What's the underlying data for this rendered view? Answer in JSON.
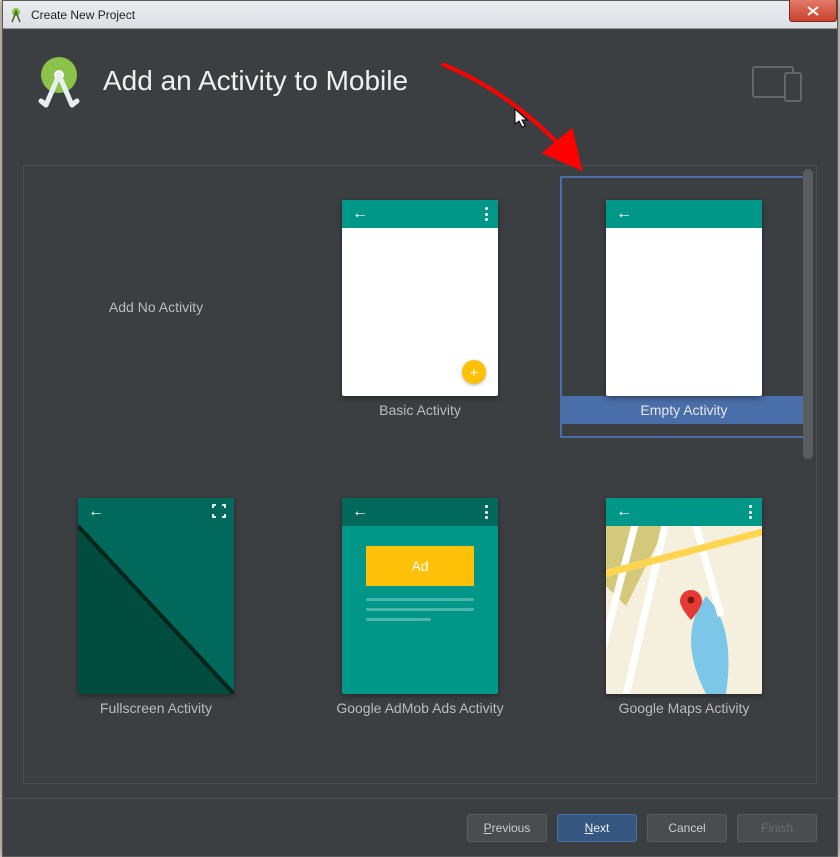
{
  "window": {
    "title": "Create New Project",
    "close_label": "X"
  },
  "header": {
    "title": "Add an Activity to Mobile"
  },
  "templates": [
    {
      "id": "none",
      "label": "Add No Activity",
      "kind": "none",
      "selected": false
    },
    {
      "id": "basic",
      "label": "Basic Activity",
      "kind": "basic",
      "selected": false
    },
    {
      "id": "empty",
      "label": "Empty Activity",
      "kind": "empty",
      "selected": true
    },
    {
      "id": "fullscreen",
      "label": "Fullscreen Activity",
      "kind": "fullscreen",
      "selected": false
    },
    {
      "id": "admob",
      "label": "Google AdMob Ads Activity",
      "kind": "admob",
      "selected": false
    },
    {
      "id": "maps",
      "label": "Google Maps Activity",
      "kind": "maps",
      "selected": false
    }
  ],
  "admob": {
    "ad_label": "Ad"
  },
  "footer": {
    "previous": "Previous",
    "next": "Next",
    "cancel": "Cancel",
    "finish": "Finish"
  }
}
